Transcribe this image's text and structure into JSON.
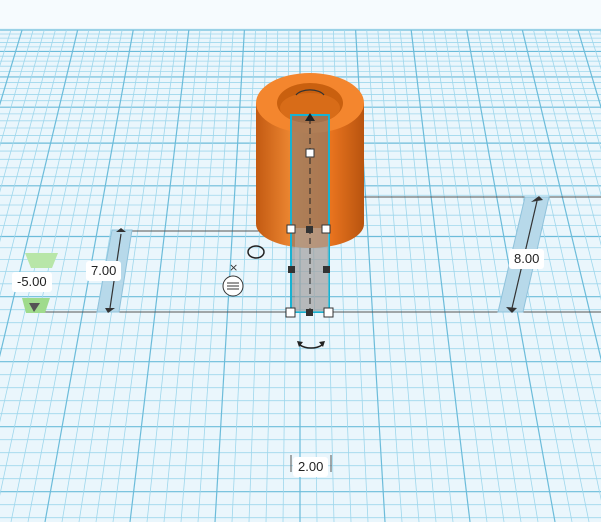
{
  "workplane": {
    "grid_color": "#9fd7ec",
    "major_grid_color": "#6cbcda",
    "background_color": "#eaf6fc"
  },
  "shapes": {
    "cylinder": {
      "color": "#e8731e",
      "shadow_color": "#b8540f"
    },
    "box": {
      "outline_color": "#17b2d2"
    }
  },
  "dimensions": {
    "elevation": "-5.00",
    "box_height": "7.00",
    "cylinder_height": "8.00",
    "width": "2.00"
  },
  "icons": {
    "close_glyph": "×",
    "rotate_glyph": "↶",
    "menu_glyph": "≡"
  }
}
